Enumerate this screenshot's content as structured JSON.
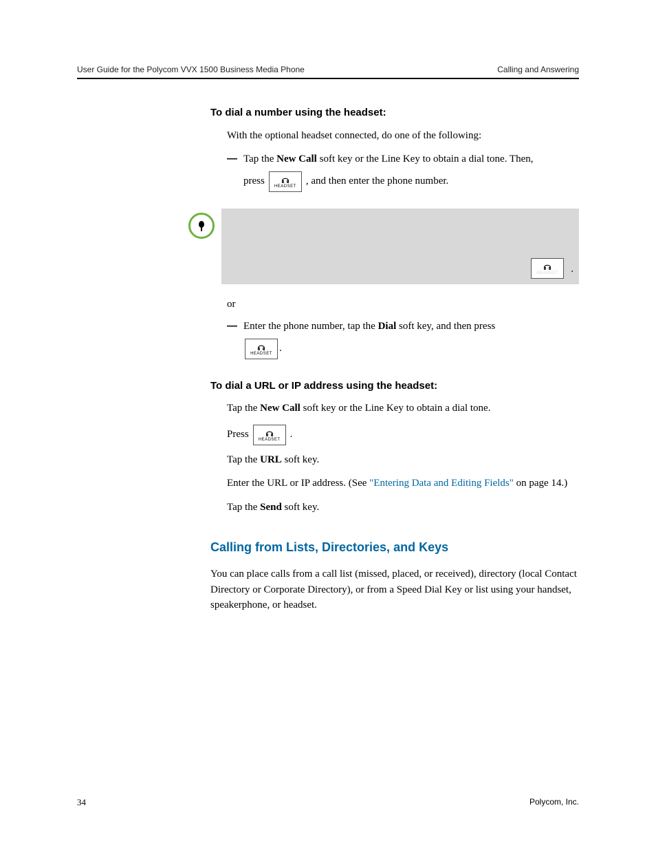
{
  "header": {
    "left": "User Guide for the Polycom VVX 1500 Business Media Phone",
    "right": "Calling and Answering"
  },
  "headset_key_label": "HEADSET",
  "section1": {
    "heading": "To dial a number using the headset:",
    "intro": "With the optional headset connected, do one of the following:",
    "dash": "—",
    "bullet1_a": "Tap the ",
    "bullet1_bold": "New Call",
    "bullet1_b": " soft key or the Line Key to obtain a dial tone. Then,",
    "press_word": "press",
    "after_press": ", and then enter the phone number.",
    "or": "or",
    "bullet2_a": "Enter the phone number, tap the ",
    "bullet2_bold": "Dial",
    "bullet2_b": " soft key, and then press",
    "period": ".",
    "trailing_dot": "."
  },
  "section2": {
    "heading": "To dial a URL or IP address using the headset:",
    "p1_a": "Tap the ",
    "p1_bold": "New Call",
    "p1_b": " soft key or the Line Key to obtain a dial tone.",
    "press_word": "Press",
    "press_period": ".",
    "p3_a": "Tap the ",
    "p3_bold": "URL",
    "p3_b": " soft key.",
    "p4_a": "Enter the URL or IP address. (See ",
    "p4_link": "\"Entering Data and Editing Fields\"",
    "p4_b": " on page 14.)",
    "p5_a": "Tap the ",
    "p5_bold": "Send",
    "p5_b": " soft key."
  },
  "section3": {
    "heading": "Calling from Lists, Directories, and Keys",
    "body": "You can place calls from a call list (missed, placed, or received), directory (local Contact Directory or Corporate Directory), or from a Speed Dial Key or list using your handset, speakerphone, or headset."
  },
  "footer": {
    "page": "34",
    "company": "Polycom, Inc."
  }
}
